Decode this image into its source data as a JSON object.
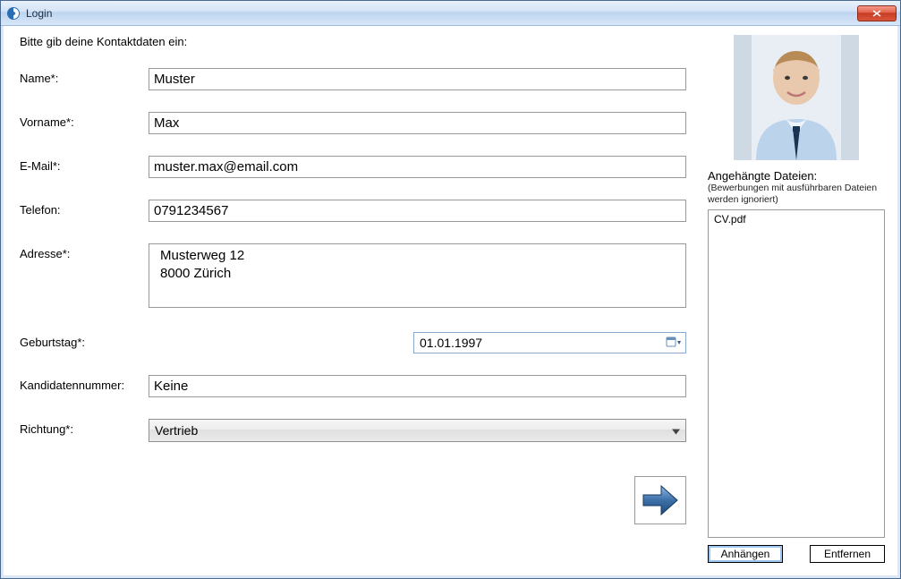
{
  "window": {
    "title": "Login"
  },
  "instruction": "Bitte gib deine Kontaktdaten ein:",
  "form": {
    "name": {
      "label": "Name*:",
      "value": "Muster"
    },
    "vorname": {
      "label": "Vorname*:",
      "value": "Max"
    },
    "email": {
      "label": "E-Mail*:",
      "value": "muster.max@email.com"
    },
    "telefon": {
      "label": "Telefon:",
      "value": "0791234567"
    },
    "adresse": {
      "label": "Adresse*:",
      "value": "Musterweg 12\n8000 Zürich"
    },
    "geburtstag": {
      "label": "Geburtstag*:",
      "value": "01.01.1997"
    },
    "kandidatennummer": {
      "label": "Kandidatennummer:",
      "value": "Keine"
    },
    "richtung": {
      "label": "Richtung*:",
      "value": "Vertrieb"
    }
  },
  "attachments": {
    "label": "Angehängte Dateien:",
    "hint": "(Bewerbungen mit ausführbaren Dateien werden ignoriert)",
    "files": [
      "CV.pdf"
    ],
    "attach_btn": "Anhängen",
    "remove_btn": "Entfernen"
  }
}
